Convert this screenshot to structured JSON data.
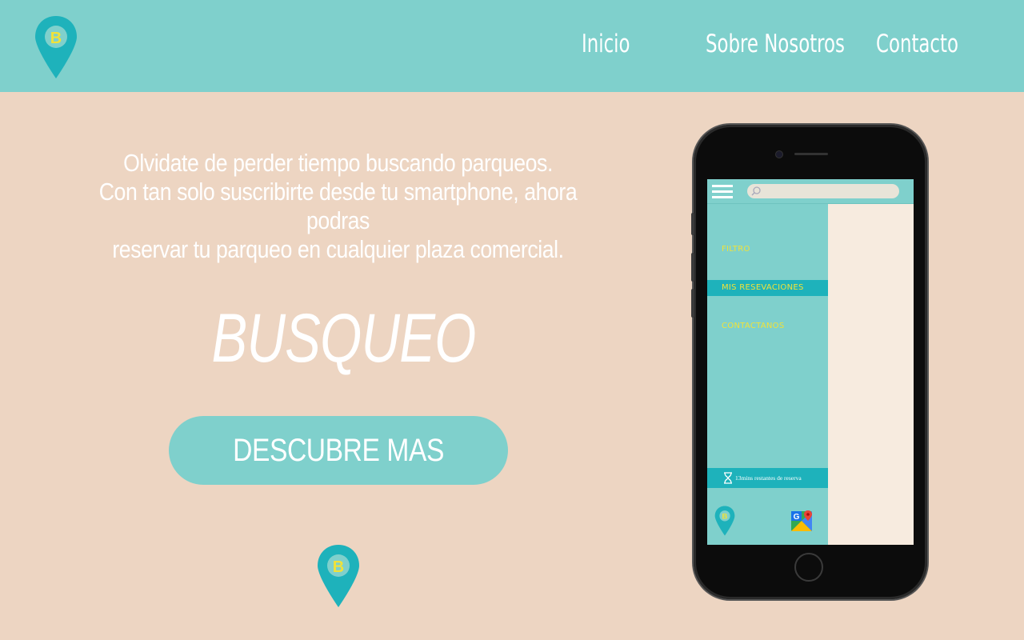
{
  "nav": {
    "logo_letter": "B",
    "links": [
      {
        "label": "Inicio"
      },
      {
        "label": "Sobre Nosotros"
      },
      {
        "label": "Contacto"
      }
    ]
  },
  "hero": {
    "lines": [
      "Olvidate de perder tiempo buscando parqueos.",
      "Con tan solo suscribirte desde tu smartphone, ahora podras",
      "reservar tu parqueo en cualquier plaza comercial."
    ],
    "brand": "BUSQUEO",
    "cta_label": "DESCUBRE MAS"
  },
  "bottom_logo_letter": "B",
  "phone": {
    "menu": [
      {
        "label": "FILTRO",
        "active": false
      },
      {
        "label": "MIS RESEVACIONES",
        "active": true
      },
      {
        "label": "CONTACTANOS",
        "active": false
      }
    ],
    "timer_text": "13mins restantes de reserva",
    "app_logo_letter": "B",
    "maps_letter": "G"
  },
  "colors": {
    "header_bg": "#7fd0cc",
    "page_bg": "#edd5c2",
    "pin_teal": "#1eb2bb",
    "pin_inner": "#7fd0cc",
    "logo_letter": "#f0e23a",
    "menu_text": "#f0e23a",
    "active_menu_bg": "#1eb2bb",
    "panel_bg": "#f7ebdf"
  },
  "icons": [
    "location-pin-logo",
    "hamburger-menu-icon",
    "search-icon",
    "hourglass-icon",
    "google-maps-icon"
  ]
}
